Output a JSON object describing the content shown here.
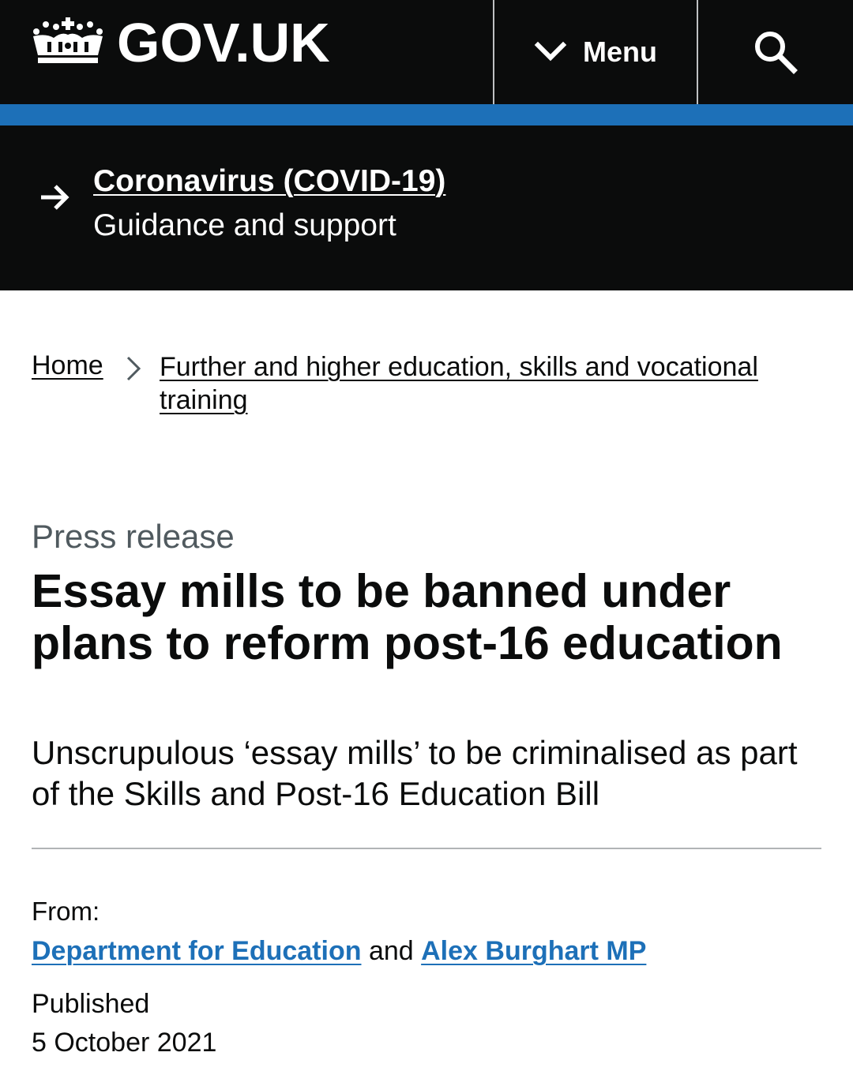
{
  "header": {
    "logo_text": "GOV.UK",
    "menu_label": "Menu"
  },
  "covid_banner": {
    "link_text": "Coronavirus (COVID-19)",
    "subtitle": "Guidance and support"
  },
  "breadcrumbs": [
    {
      "label": "Home"
    },
    {
      "label": "Further and higher education, skills and vocational training"
    }
  ],
  "article": {
    "caption": "Press release",
    "title": "Essay mills to be banned under plans to reform post-16 education",
    "lede": "Unscrupulous ‘essay mills’ to be criminalised as part of the Skills and Post-16 Education Bill"
  },
  "metadata": {
    "from_label": "From:",
    "organisations": [
      {
        "label": "Department for Education"
      },
      {
        "label": "Alex Burghart MP"
      }
    ],
    "conjunction": "and",
    "published_label": "Published",
    "published_date": "5 October 2021"
  },
  "colors": {
    "header_bg": "#0b0c0c",
    "brand_blue": "#1d70b8",
    "link_blue": "#1d70b8",
    "secondary_text": "#505a5f"
  }
}
